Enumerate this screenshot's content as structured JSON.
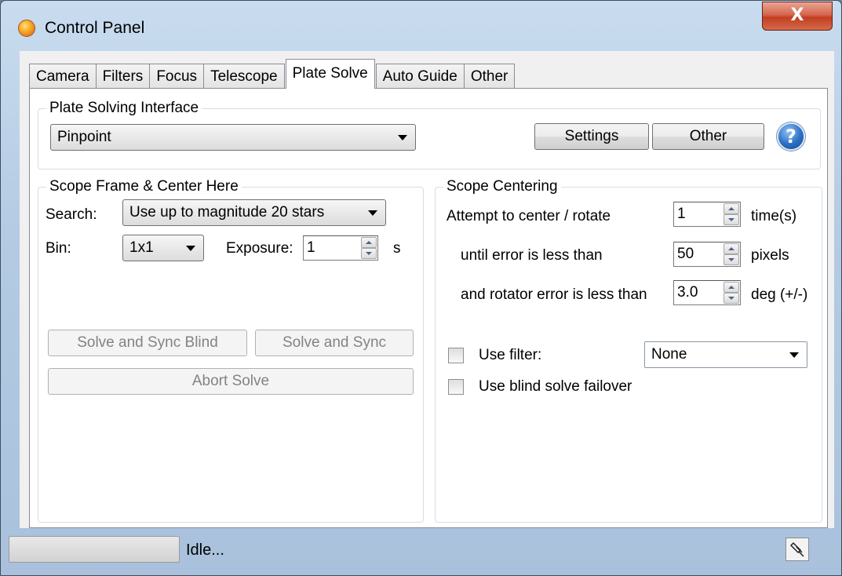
{
  "window": {
    "title": "Control Panel",
    "close_label": "X"
  },
  "tabs": [
    {
      "label": "Camera"
    },
    {
      "label": "Filters"
    },
    {
      "label": "Focus"
    },
    {
      "label": "Telescope"
    },
    {
      "label": "Plate Solve",
      "active": true
    },
    {
      "label": "Auto Guide"
    },
    {
      "label": "Other"
    }
  ],
  "plate_interface": {
    "legend": "Plate Solving Interface",
    "selected": "Pinpoint",
    "settings_label": "Settings",
    "other_label": "Other",
    "help_glyph": "?"
  },
  "scope_frame": {
    "legend": "Scope Frame & Center Here",
    "search_label": "Search:",
    "search_value": "Use up to magnitude 20 stars",
    "bin_label": "Bin:",
    "bin_value": "1x1",
    "exposure_label": "Exposure:",
    "exposure_value": "1",
    "exposure_unit": "s",
    "solve_blind_label": "Solve and Sync Blind",
    "solve_sync_label": "Solve and Sync",
    "abort_label": "Abort Solve"
  },
  "scope_centering": {
    "legend": "Scope Centering",
    "attempt_label": "Attempt to center / rotate",
    "attempt_value": "1",
    "attempt_unit": "time(s)",
    "until_label": "until error is less than",
    "until_value": "50",
    "until_unit": "pixels",
    "rotator_label": "and rotator error is less than",
    "rotator_value": "3.0",
    "rotator_unit": "deg (+/-)",
    "use_filter_label": "Use filter:",
    "use_filter_checked": false,
    "filter_value": "None",
    "failover_label": "Use blind solve failover",
    "failover_checked": false
  },
  "status": {
    "text": "Idle...",
    "progress": 0
  },
  "icons": {
    "app": "app-orange-orb-icon",
    "help": "help-question-icon",
    "pin": "pin-icon",
    "dropdown": "chevron-down-icon"
  }
}
